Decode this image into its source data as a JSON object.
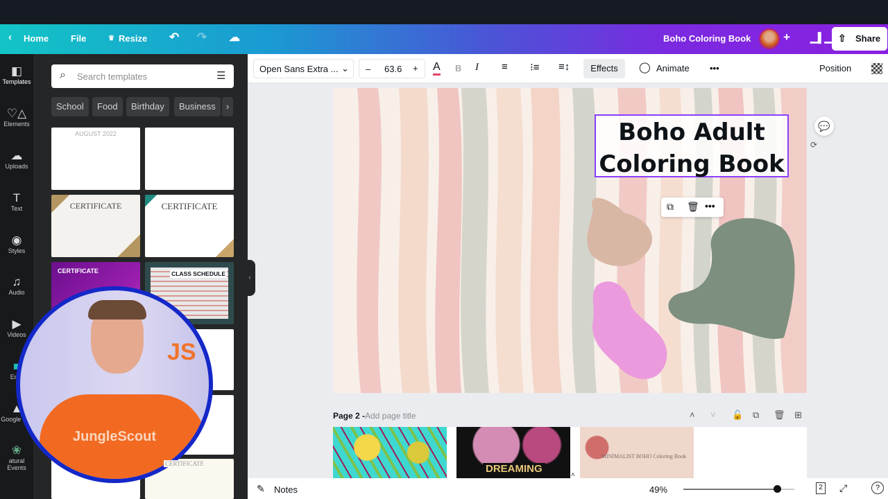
{
  "header": {
    "home": "Home",
    "file": "File",
    "resize": "Resize",
    "title": "Boho Coloring Book",
    "share": "Share",
    "colors": {
      "gradient_start": "#13c4c6",
      "gradient_end": "#8a1fe0"
    }
  },
  "rail": {
    "items": [
      {
        "label": "Templates",
        "icon": "templates-icon"
      },
      {
        "label": "Elements",
        "icon": "elements-icon"
      },
      {
        "label": "Uploads",
        "icon": "upload-cloud-icon"
      },
      {
        "label": "Text",
        "icon": "text-icon"
      },
      {
        "label": "Styles",
        "icon": "palette-icon"
      },
      {
        "label": "Audio",
        "icon": "music-note-icon"
      },
      {
        "label": "Videos",
        "icon": "video-icon"
      },
      {
        "label": "En...",
        "icon": "app-icon"
      },
      {
        "label": "Google D...",
        "icon": "google-drive-icon"
      },
      {
        "label": "atural Events",
        "icon": "natural-events-icon"
      }
    ]
  },
  "panel": {
    "search_placeholder": "Search templates",
    "chips": [
      "School",
      "Food",
      "Birthday",
      "Business"
    ],
    "thumbs": [
      "AUGUST 2022",
      "CERTIFICATE",
      "CERTIFICATE",
      "CERTIFICATE",
      "CLASS SCHEDULE",
      "CERTIFICATE"
    ]
  },
  "toolbar": {
    "font": "Open Sans Extra ...",
    "size": "63.6",
    "minus": "–",
    "plus": "+",
    "effects": "Effects",
    "animate": "Animate",
    "position": "Position"
  },
  "canvas": {
    "heading_line1": "Boho Adult",
    "heading_line2": "Coloring Book"
  },
  "page2": {
    "label": "Page 2 - ",
    "title_placeholder": "Add page title",
    "thumbs": [
      "",
      "DREAMING",
      "MINIMALIST BOHO Coloring Book"
    ]
  },
  "webcam": {
    "shirt_text": "JungleScout"
  },
  "bottom": {
    "notes": "Notes",
    "zoom": "49%",
    "zoom_fraction": 0.49,
    "page_count": "2"
  }
}
